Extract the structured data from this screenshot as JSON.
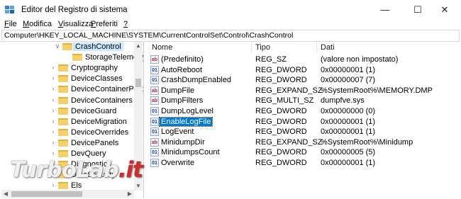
{
  "window": {
    "title": "Editor del Registro di sistema",
    "icon": "regedit-icon",
    "controls": [
      "—",
      "☐",
      "✕"
    ]
  },
  "menu": [
    {
      "label": "File",
      "ul": "F",
      "rest": "ile"
    },
    {
      "label": "Modifica",
      "ul": "M",
      "rest": "odifica"
    },
    {
      "label": "Visualizza",
      "ul": "V",
      "rest": "isualizza"
    },
    {
      "label": "Preferiti",
      "ul": "P",
      "rest": "referiti"
    },
    {
      "label": "?",
      "ul": "?",
      "rest": ""
    }
  ],
  "address": "Computer\\HKEY_LOCAL_MACHINE\\SYSTEM\\CurrentControlSet\\Control\\CrashControl",
  "tree": [
    {
      "label": "CrashControl",
      "arrow": "∨",
      "level": 1,
      "selected": true
    },
    {
      "label": "StorageTelemetry",
      "arrow": "",
      "level": 2,
      "selected": false
    },
    {
      "label": "Cryptography",
      "arrow": "›",
      "level": 0,
      "selected": false
    },
    {
      "label": "DeviceClasses",
      "arrow": "›",
      "level": 0,
      "selected": false
    },
    {
      "label": "DeviceContainerProper",
      "arrow": "›",
      "level": 0,
      "selected": false
    },
    {
      "label": "DeviceContainers",
      "arrow": "›",
      "level": 0,
      "selected": false
    },
    {
      "label": "DeviceGuard",
      "arrow": "›",
      "level": 0,
      "selected": false
    },
    {
      "label": "DeviceMigration",
      "arrow": "›",
      "level": 0,
      "selected": false
    },
    {
      "label": "DeviceOverrides",
      "arrow": "›",
      "level": 0,
      "selected": false
    },
    {
      "label": "DevicePanels",
      "arrow": "›",
      "level": 0,
      "selected": false
    },
    {
      "label": "DevQuery",
      "arrow": "›",
      "level": 0,
      "selected": false
    },
    {
      "label": "Diagnostics",
      "arrow": "›",
      "level": 0,
      "selected": false
    },
    {
      "label": "DmaSecurity",
      "arrow": "›",
      "level": 0,
      "selected": false
    },
    {
      "label": "Els",
      "arrow": "›",
      "level": 0,
      "selected": false
    }
  ],
  "columns": {
    "name": "Nome",
    "type": "Tipo",
    "data": "Dati"
  },
  "values": [
    {
      "name": "(Predefinito)",
      "type": "REG_SZ",
      "data": "(valore non impostato)",
      "icon": "ab",
      "selected": false
    },
    {
      "name": "AutoReboot",
      "type": "REG_DWORD",
      "data": "0x00000001 (1)",
      "icon": "bin",
      "selected": false
    },
    {
      "name": "CrashDumpEnabled",
      "type": "REG_DWORD",
      "data": "0x00000007 (7)",
      "icon": "bin",
      "selected": false
    },
    {
      "name": "DumpFile",
      "type": "REG_EXPAND_SZ",
      "data": "%SystemRoot%\\MEMORY.DMP",
      "icon": "ab",
      "selected": false
    },
    {
      "name": "DumpFilters",
      "type": "REG_MULTI_SZ",
      "data": "dumpfve.sys",
      "icon": "ab",
      "selected": false
    },
    {
      "name": "DumpLogLevel",
      "type": "REG_DWORD",
      "data": "0x00000000 (0)",
      "icon": "bin",
      "selected": false
    },
    {
      "name": "EnableLogFile",
      "type": "REG_DWORD",
      "data": "0x00000001 (1)",
      "icon": "bin",
      "selected": true
    },
    {
      "name": "LogEvent",
      "type": "REG_DWORD",
      "data": "0x00000001 (1)",
      "icon": "bin",
      "selected": false
    },
    {
      "name": "MinidumpDir",
      "type": "REG_EXPAND_SZ",
      "data": "%SystemRoot%\\Minidump",
      "icon": "ab",
      "selected": false
    },
    {
      "name": "MinidumpsCount",
      "type": "REG_DWORD",
      "data": "0x00000005 (5)",
      "icon": "bin",
      "selected": false
    },
    {
      "name": "Overwrite",
      "type": "REG_DWORD",
      "data": "0x00000001 (1)",
      "icon": "bin",
      "selected": false
    }
  ],
  "watermark": {
    "part1": "TurboLab",
    "part2": ".it"
  },
  "icon_text": {
    "ab": "ab",
    "bin": "01"
  }
}
